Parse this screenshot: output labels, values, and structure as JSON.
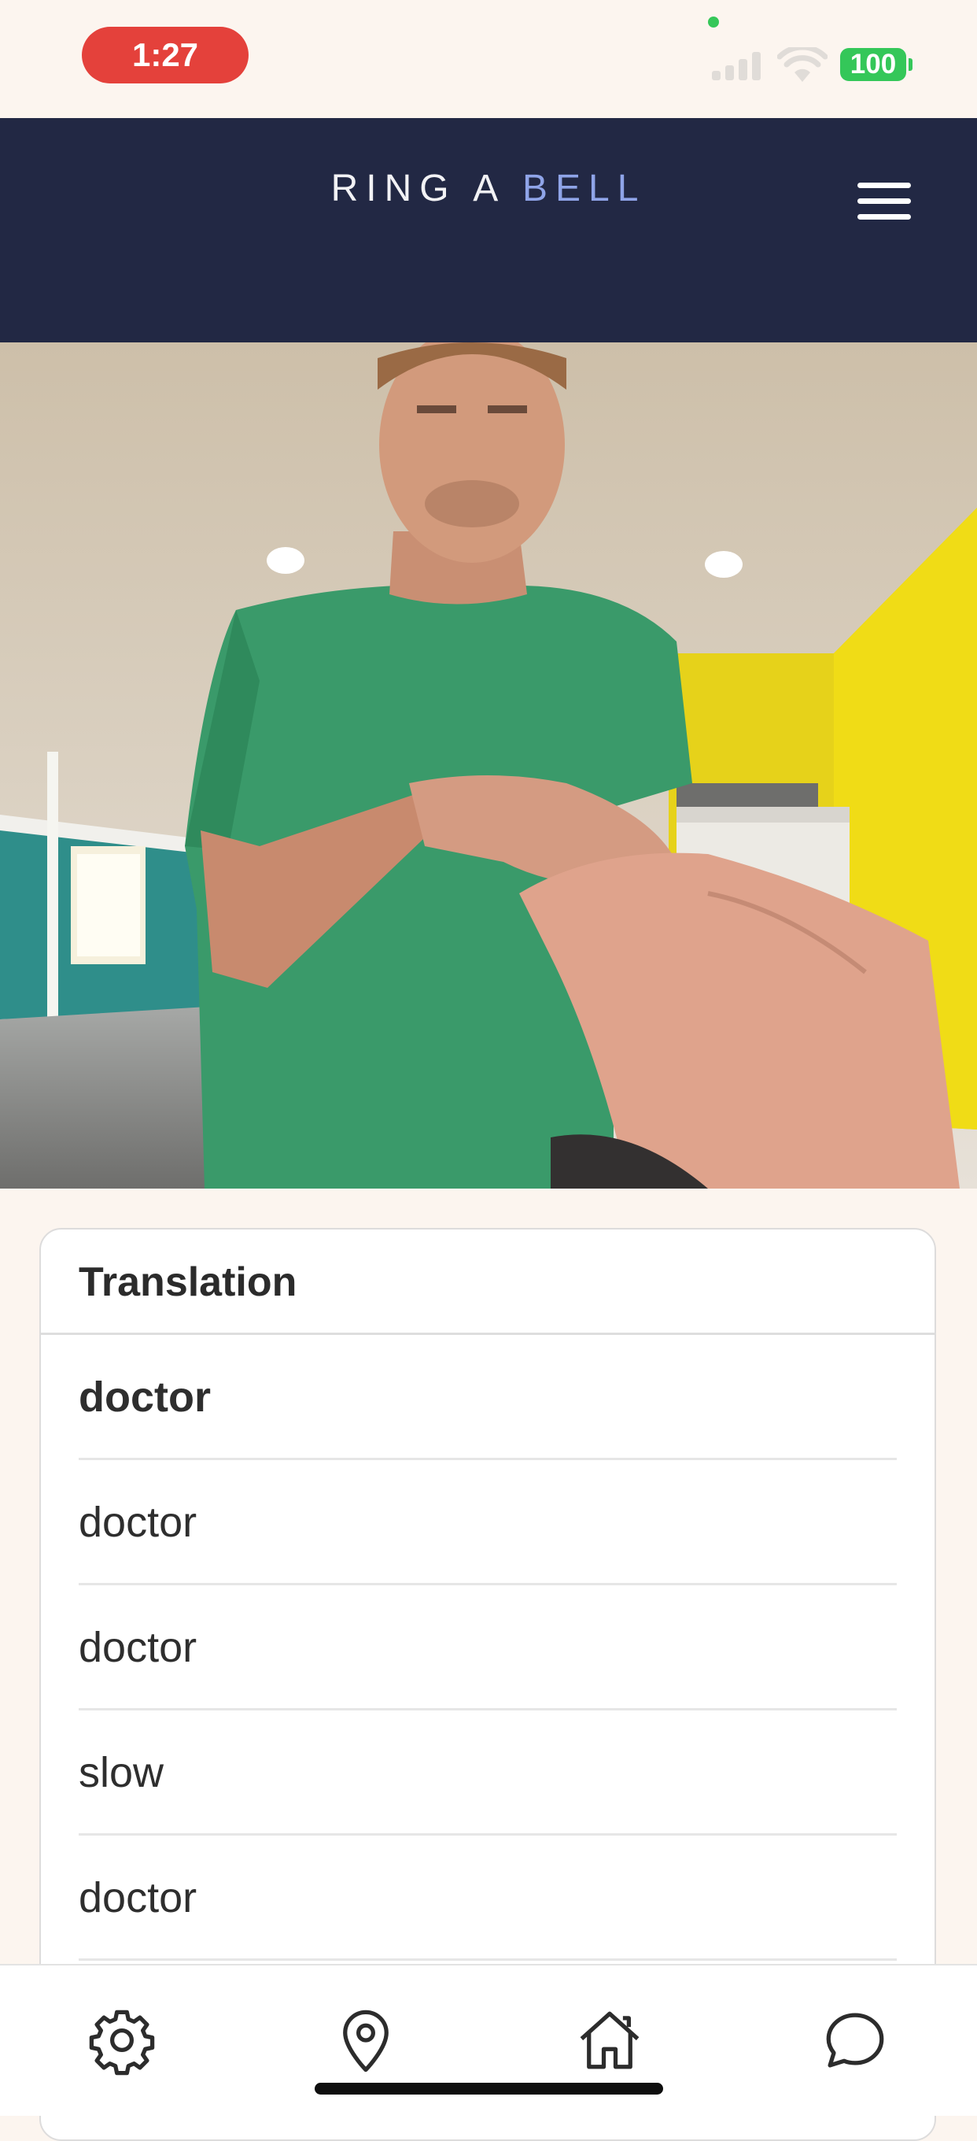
{
  "status_bar": {
    "time": "1:27",
    "battery": "100"
  },
  "header": {
    "brand_primary": "RING A",
    "brand_accent": "BELL",
    "accent_color": "#8fa4e8",
    "background_color": "#222844"
  },
  "camera_feed": {
    "icon": "person-signing-photo"
  },
  "translation": {
    "title": "Translation",
    "items": [
      {
        "label": "doctor"
      },
      {
        "label": "doctor"
      },
      {
        "label": "doctor"
      },
      {
        "label": "slow"
      },
      {
        "label": "doctor"
      }
    ]
  },
  "bottom_nav": {
    "items": [
      {
        "icon": "gear-icon"
      },
      {
        "icon": "map-pin-icon"
      },
      {
        "icon": "home-icon"
      },
      {
        "icon": "chat-bubble-icon"
      }
    ]
  }
}
